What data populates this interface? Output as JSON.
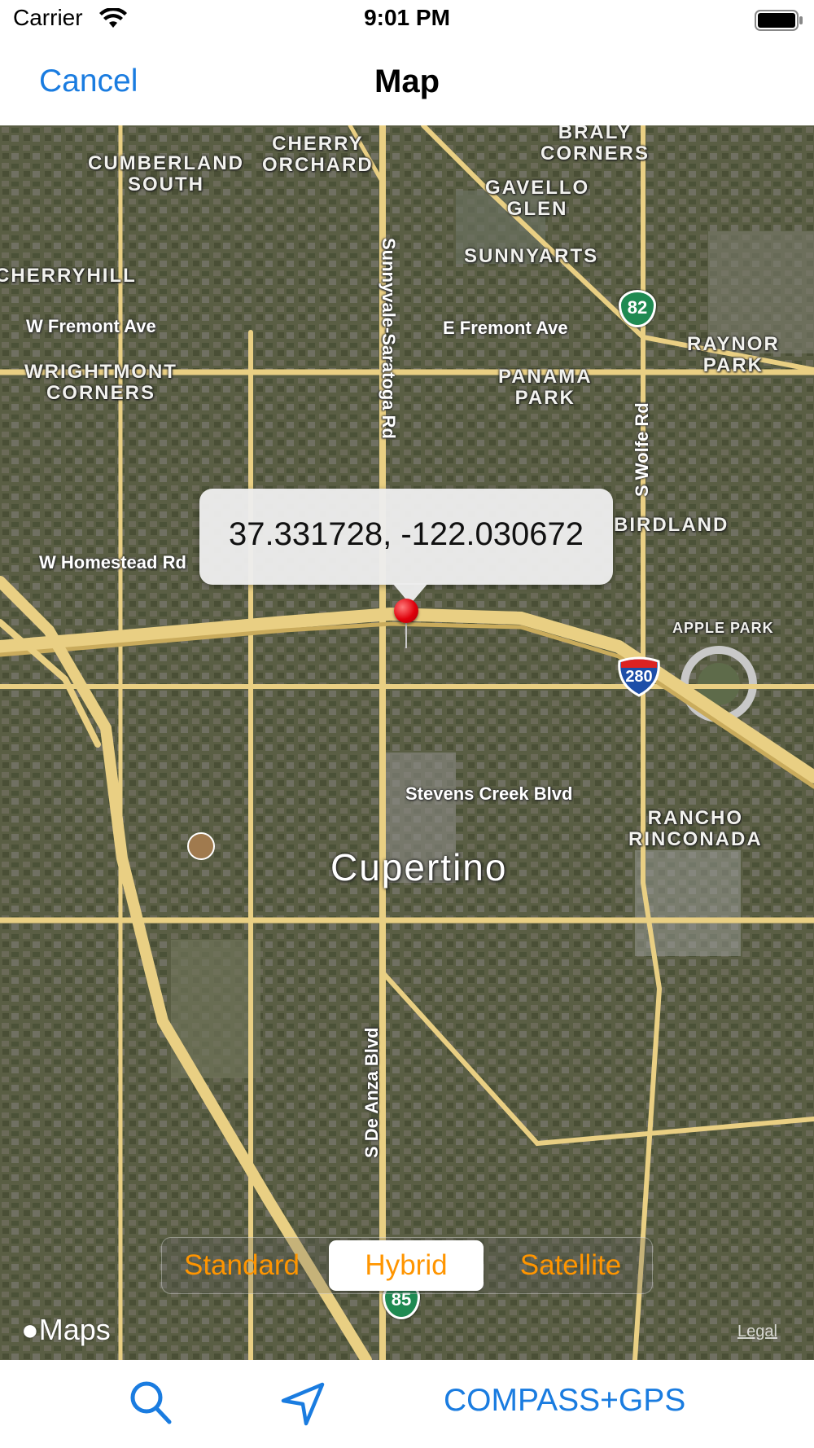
{
  "status_bar": {
    "carrier": "Carrier",
    "time": "9:01 PM"
  },
  "nav": {
    "cancel_label": "Cancel",
    "title": "Map"
  },
  "map": {
    "callout_text": "37.331728, -122.030672",
    "neighborhoods": [
      "CUMBERLAND\nSOUTH",
      "CHERRY\nORCHARD",
      "BRALY\nCORNERS",
      "GAVELLO\nGLEN",
      "SUNNYARTS",
      "CHERRYHILL",
      "WRIGHTMONT\nCORNERS",
      "PANAMA\nPARK",
      "RAYNOR\nPARK",
      "BIRDLAND",
      "APPLE PARK",
      "RANCHO\nRINCONADA"
    ],
    "roads": [
      "W Fremont Ave",
      "E Fremont Ave",
      "Sunnyvale-Saratoga Rd",
      "S Wolfe Rd",
      "W Homestead Rd",
      "Stevens Creek Blvd",
      "S De Anza Blvd"
    ],
    "city": "Cupertino",
    "shields": {
      "sr82": "82",
      "i280": "280",
      "sr85": "85"
    },
    "attribution": "Maps",
    "legal": "Legal"
  },
  "map_type": {
    "options": [
      "Standard",
      "Hybrid",
      "Satellite"
    ],
    "selected": "Hybrid"
  },
  "toolbar": {
    "search_icon": "search-icon",
    "location_icon": "location-arrow-icon",
    "compass_label": "COMPASS+GPS"
  },
  "colors": {
    "accent": "#1a7ce0",
    "segment_text": "#ff9500",
    "pin": "#e0000b",
    "road": "#e9cf83"
  }
}
